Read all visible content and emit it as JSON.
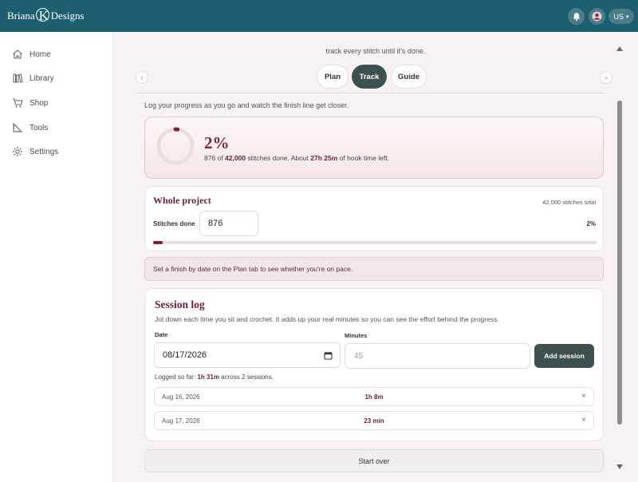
{
  "brand": {
    "left": "Briana",
    "monogram": "K",
    "right": "Designs"
  },
  "header": {
    "lang_label": "US",
    "lang_caret": "▾"
  },
  "sidebar": {
    "items": [
      {
        "label": "Home",
        "icon": "home-icon"
      },
      {
        "label": "Library",
        "icon": "library-icon"
      },
      {
        "label": "Shop",
        "icon": "cart-icon"
      },
      {
        "label": "Tools",
        "icon": "ruler-icon"
      },
      {
        "label": "Settings",
        "icon": "gear-icon"
      }
    ]
  },
  "main": {
    "tagline": "track every stitch until it's done.",
    "tabs": [
      {
        "label": "Plan",
        "active": false
      },
      {
        "label": "Track",
        "active": true
      },
      {
        "label": "Guide",
        "active": false
      }
    ],
    "prev_arrow": "‹",
    "next_arrow": "›",
    "intro": "Log your progress as you go and watch the finish line get closer."
  },
  "summary": {
    "percent_label": "2%",
    "progress_fraction": 0.0209,
    "done": "876",
    "of_text": " of ",
    "total": "42,000",
    "mid_text": " stitches done. About ",
    "time_left": "27h 25m",
    "end_text": " of hook time left."
  },
  "whole_project": {
    "title": "Whole project",
    "total_label": "42,000 stitches total",
    "stitches_label": "Stitches done",
    "stitches_value": "876",
    "percent_label": "2%",
    "progress_fraction": 0.0209
  },
  "alert": {
    "text": "Set a finish by date on the Plan tab to see whether you're on pace."
  },
  "session_log": {
    "title": "Session log",
    "description": "Jot down each time you sit and crochet. It adds up your real minutes so you can see the effort behind the progress.",
    "date_label": "Date",
    "date_value": "08/17/2026",
    "minutes_label": "Minutes",
    "minutes_placeholder": "45",
    "add_button": "Add session",
    "logged_prefix": "Logged so far: ",
    "logged_total": "1h 31m",
    "logged_suffix": " across 2 sessions.",
    "entries": [
      {
        "date": "Aug 16, 2026",
        "duration": "1h 8m",
        "remove": "×"
      },
      {
        "date": "Aug 17, 2026",
        "duration": "23 min",
        "remove": "×"
      }
    ]
  },
  "start_over": "Start over",
  "colors": {
    "header_bg": "#1d5e6f",
    "accent": "#7c2340",
    "button_dark": "#3e504f",
    "main_bg": "#f8f3f2"
  }
}
